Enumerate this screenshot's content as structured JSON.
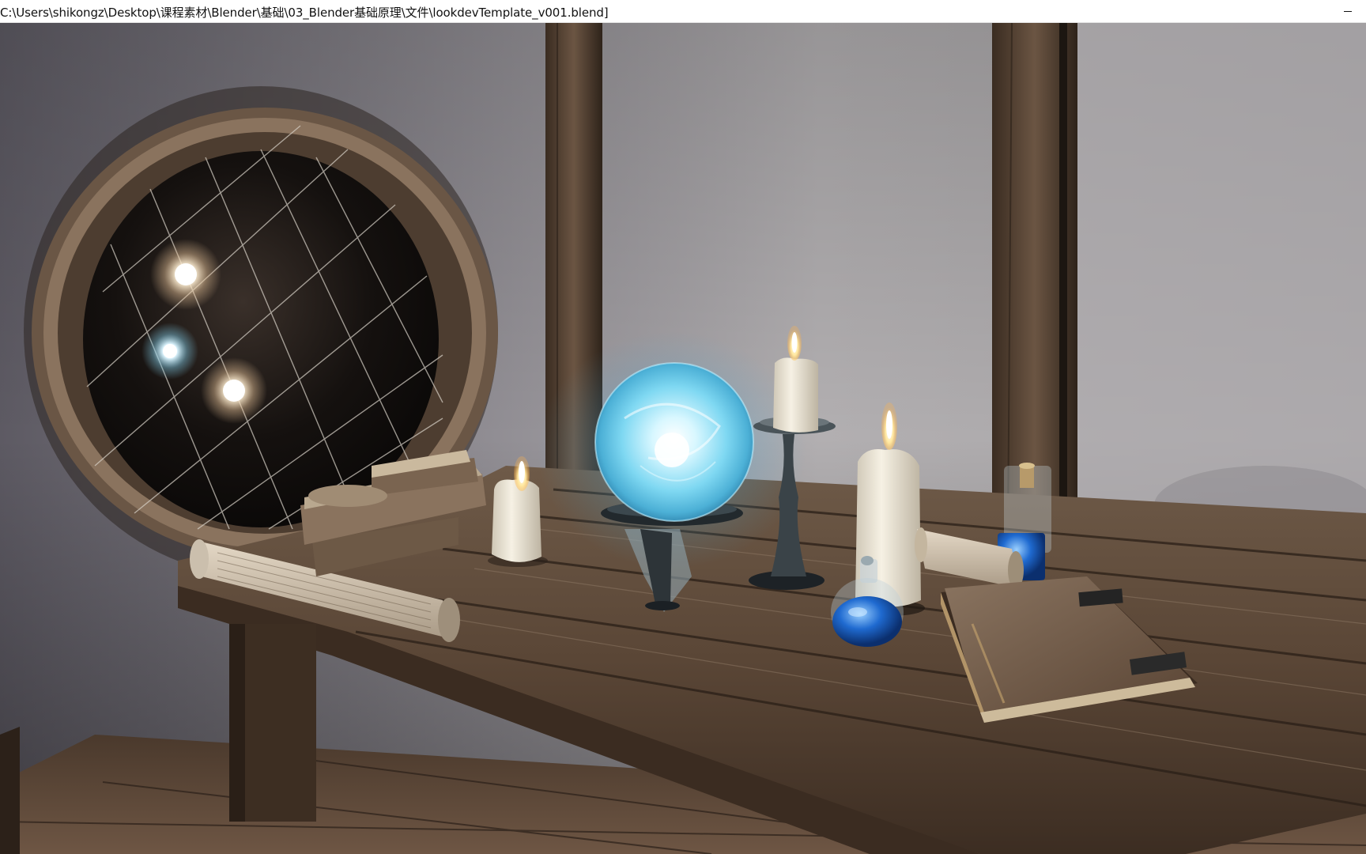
{
  "window": {
    "title": "C:\\Users\\shikongz\\Desktop\\课程素材\\Blender\\基础\\03_Blender基础原理\\文件\\lookdevTemplate_v001.blend]",
    "controls": {
      "minimize_icon": "minimize-icon"
    }
  },
  "viewport": {
    "mode": "rendered",
    "colors": {
      "wall": "#a9a6a8",
      "wood_dark": "#3e2e22",
      "wood_light": "#6f5a46",
      "orb_glow": "#7fd8f2",
      "potion_blue": "#1f6ad0",
      "candle_wax": "#efe9da",
      "flame": "#ffe8a0"
    }
  }
}
